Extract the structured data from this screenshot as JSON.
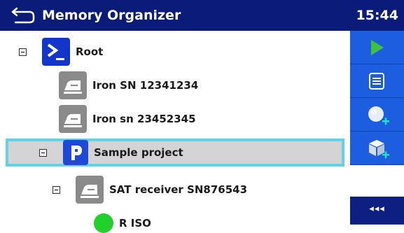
{
  "header": {
    "title": "Memory Organizer",
    "time": "15:44"
  },
  "tree": {
    "items": [
      {
        "label": "Root",
        "icon": "root-icon"
      },
      {
        "label": "Iron SN 12341234",
        "icon": "iron-icon"
      },
      {
        "label": "Iron sn 23452345",
        "icon": "iron-icon"
      },
      {
        "label": "Sample project",
        "icon": "project-icon",
        "selected": true
      },
      {
        "label": "SAT receiver SN876543",
        "icon": "iron-icon"
      },
      {
        "label": "R ISO",
        "icon": "status-dot-icon",
        "status_color": "#1fd12a"
      }
    ]
  },
  "sidebar": {
    "more_label": "◂◂◂",
    "buttons": [
      "play-icon",
      "list-icon",
      "add-measurement-icon",
      "add-object-icon",
      "more-icon"
    ]
  },
  "colors": {
    "header_bg": "#0b1b7a",
    "sidebar_button": "#1d5de0",
    "selection_border": "#5fd4e6",
    "selection_bg": "#d4d4d4",
    "play_green": "#3ec43a",
    "status_green": "#1fd12a"
  }
}
